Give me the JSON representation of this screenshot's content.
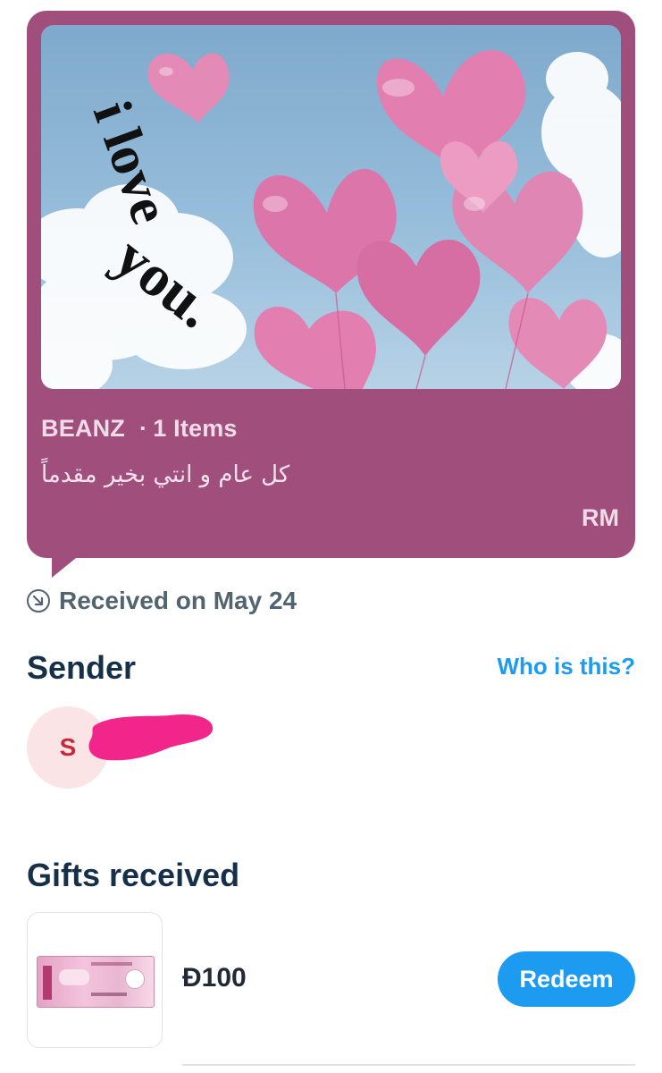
{
  "card": {
    "hero_text_1": "i love",
    "hero_text_2": "you.",
    "brand": "BEANZ",
    "items": "1 Items",
    "message": "كل عام و انتي بخير مقدماً",
    "initials": "RM",
    "colors": {
      "card_bg": "#a04e7c",
      "sky": "#8db6d6",
      "heart": "#e27fb0"
    }
  },
  "received": {
    "icon": "received-arrow-icon",
    "text": "Received on May 24"
  },
  "sender": {
    "title": "Sender",
    "who_link": "Who is this?",
    "avatar_initial": "S"
  },
  "gifts": {
    "title": "Gifts received",
    "items": [
      {
        "amount": "Ð100",
        "action": "Redeem"
      }
    ]
  },
  "colors": {
    "accent": "#1d9bf0",
    "title": "#17304a",
    "muted": "#536471"
  }
}
